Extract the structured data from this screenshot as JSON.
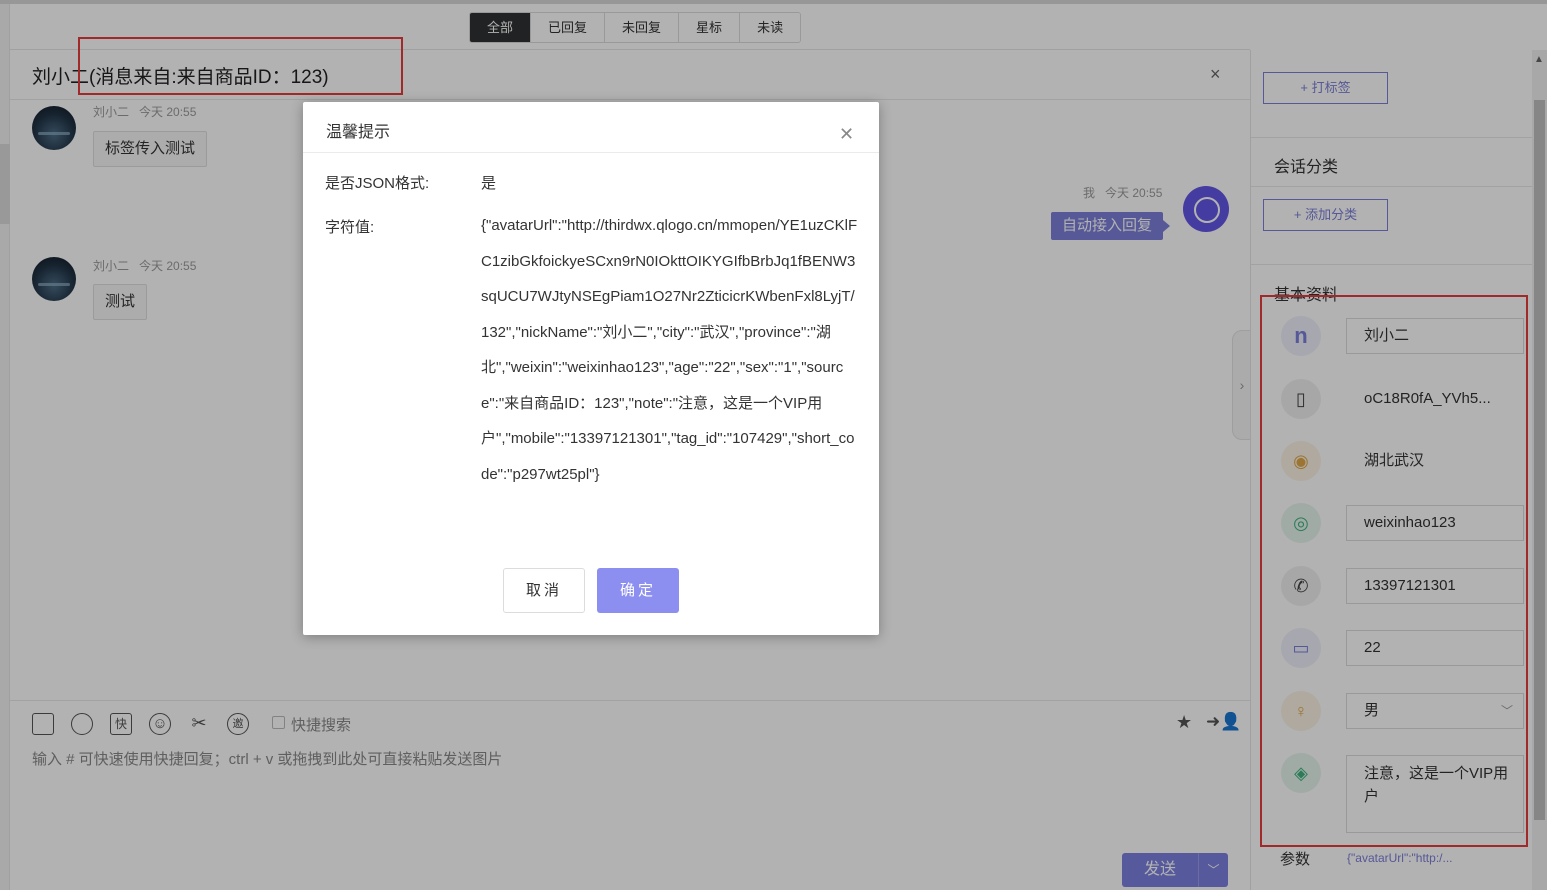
{
  "filter_tabs": [
    "全部",
    "已回复",
    "未回复",
    "星标",
    "未读"
  ],
  "conversation": {
    "title": "刘小二(消息来自:来自商品ID：123)",
    "close_icon": "×"
  },
  "messages": [
    {
      "sender": "刘小二",
      "time": "今天 20:55",
      "text": "标签传入测试"
    },
    {
      "sender": "刘小二",
      "time": "今天 20:55",
      "text": "测试"
    }
  ],
  "self_message": {
    "sender": "我",
    "time": "今天 20:55",
    "text": "自动接入回复"
  },
  "input": {
    "quick_search_label": "快捷搜索",
    "hint": "输入 # 可快速使用快捷回复；ctrl + v 或拖拽到此处可直接粘贴发送图片",
    "send_label": "发送",
    "tool_icons": [
      "chart-icon",
      "clock-icon",
      "quick-reply-icon",
      "emoji-icon",
      "scissors-icon",
      "invite-icon"
    ],
    "tool_glyphs": [
      "",
      "",
      "快",
      "☺",
      "✂",
      "邀"
    ]
  },
  "right_panel": {
    "tag_button": "+ 打标签",
    "session_category_title": "会话分类",
    "add_category_button": "+ 添加分类",
    "basic_info_title": "基本资料",
    "fields": {
      "name": "刘小二",
      "openid": "oC18R0fA_YVh5...",
      "location": "湖北武汉",
      "weixin": "weixinhao123",
      "mobile": "13397121301",
      "age": "22",
      "sex": "男",
      "note": "注意，这是一个VIP用户"
    },
    "name_icon_glyph": "n",
    "param_label": "参数",
    "param_value": "{\"avatarUrl\":\"http:/..."
  },
  "dialog": {
    "title": "温馨提示",
    "is_json_label": "是否JSON格式:",
    "is_json_value": "是",
    "string_label": "字符值:",
    "string_value": "{\"avatarUrl\":\"http://thirdwx.qlogo.cn/mmopen/YE1uzCKlFC1zibGkfoickyeSCxn9rN0IOkttOIKYGIfbBrbJq1fBENW3sqUCU7WJtyNSEgPiam1O27Nr2ZticicrKWbenFxl8LyjT/132\",\"nickName\":\"刘小二\",\"city\":\"武汉\",\"province\":\"湖北\",\"weixin\":\"weixinhao123\",\"age\":\"22\",\"sex\":\"1\",\"source\":\"来自商品ID：123\",\"note\":\"注意，这是一个VIP用户\",\"mobile\":\"13397121301\",\"tag_id\":\"107429\",\"short_code\":\"p297wt25pl\"}",
    "cancel_label": "取消",
    "ok_label": "确定"
  },
  "colors": {
    "accent": "#7b7ed8",
    "highlight_border": "#e83b3b"
  }
}
